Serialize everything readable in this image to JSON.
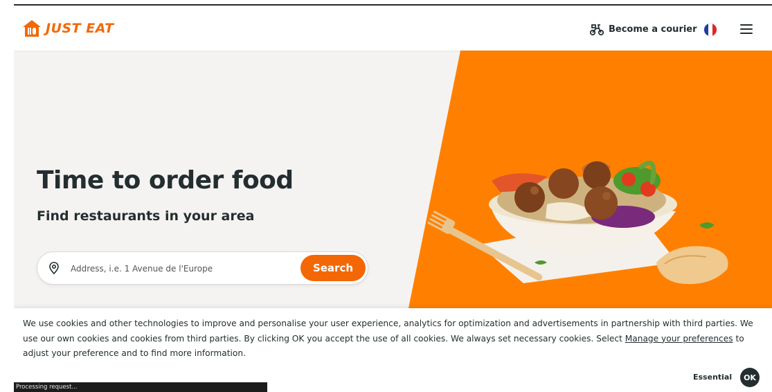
{
  "brand": {
    "name": "JUST EAT",
    "color": "#f36805"
  },
  "header": {
    "courier_label": "Become a courier",
    "courier_icon": "scooter-icon",
    "language_icon": "france-flag-icon",
    "menu_icon": "hamburger-menu-icon"
  },
  "hero": {
    "title": "Time to order food",
    "subtitle": "Find restaurants in your area",
    "search": {
      "icon": "location-pin-icon",
      "placeholder": "Address, i.e. 1 Avenue de l'Europe",
      "value": "",
      "button_label": "Search"
    },
    "image": "falafel-bowl-image"
  },
  "cookie_banner": {
    "text_before_link": "We use cookies and other technologies to improve and personalise your user experience, analytics for optimization and advertisements in partnership with third parties. We use our own cookies and cookies from third parties. By clicking OK you accept the use of all cookies. We always set necessary cookies. Select ",
    "link_text": "Manage your preferences",
    "text_after_link": " to adjust your preference and to find more information.",
    "essential_label": "Essential",
    "ok_label": "OK"
  },
  "status_bar": {
    "text": "Processing request..."
  }
}
